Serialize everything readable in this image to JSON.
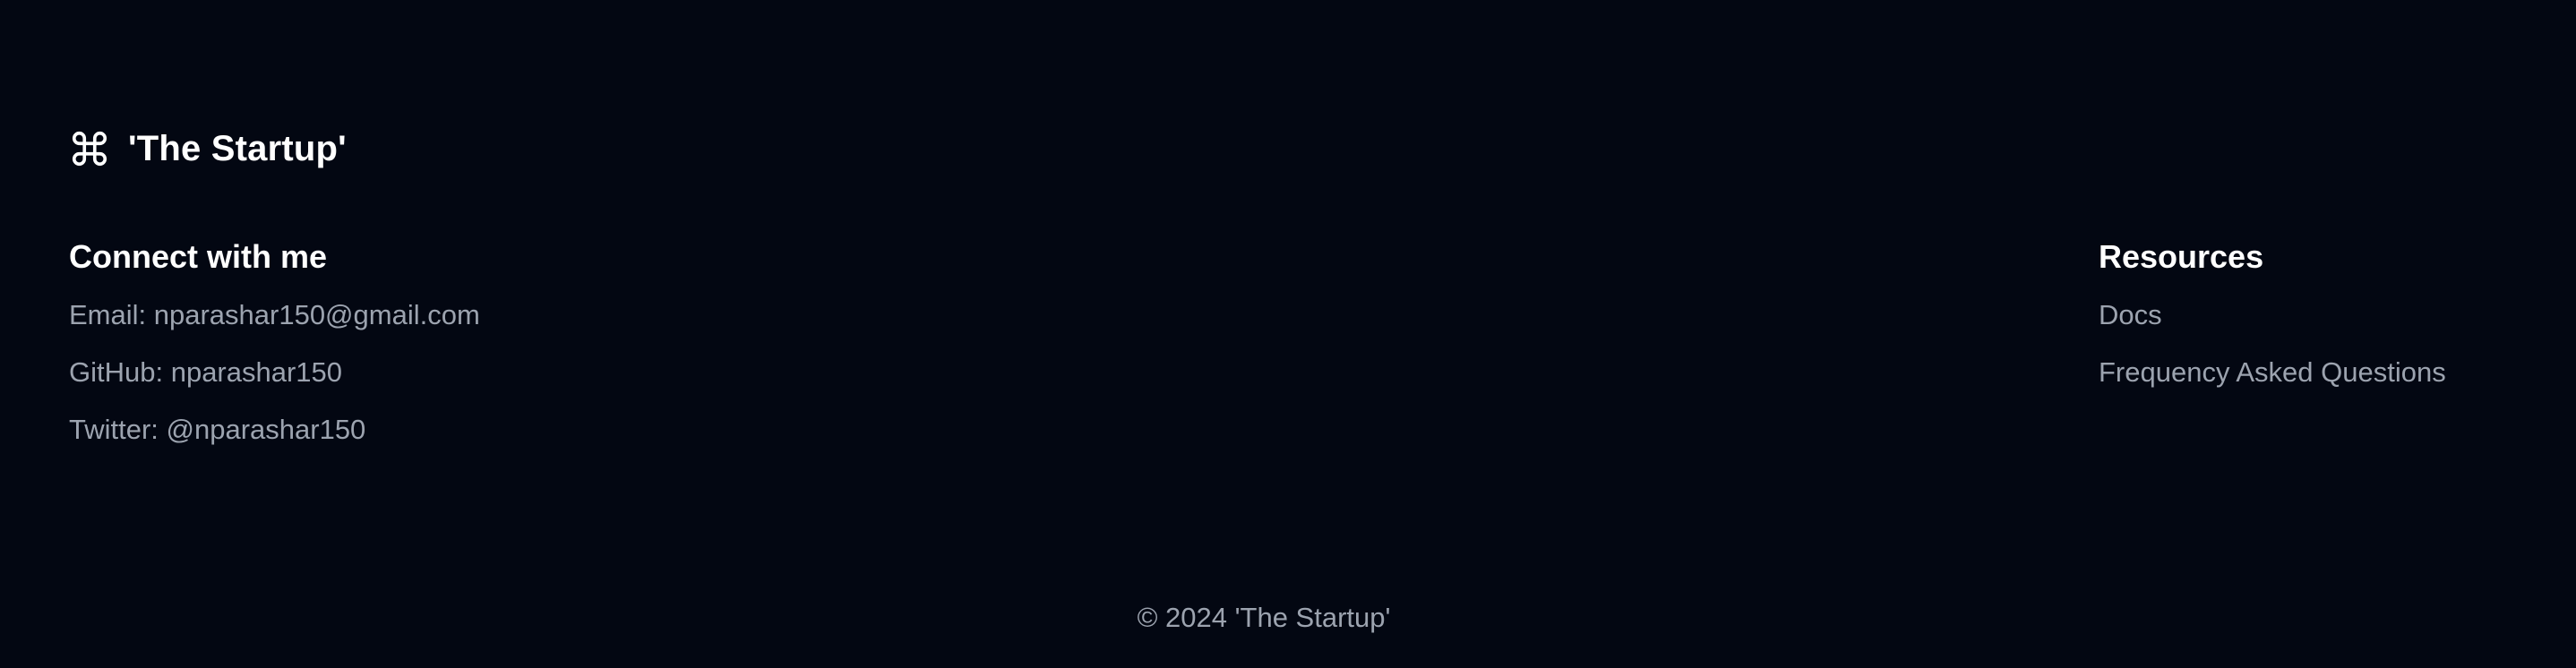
{
  "brand": {
    "icon": "command-icon",
    "title": "'The Startup'"
  },
  "connect": {
    "heading": "Connect with me",
    "items": [
      "Email: nparashar150@gmail.com",
      "GitHub: nparashar150",
      "Twitter: @nparashar150"
    ]
  },
  "resources": {
    "heading": "Resources",
    "items": [
      "Docs",
      "Frequency Asked Questions"
    ]
  },
  "footer": {
    "copyright": "© 2024 'The Startup'"
  },
  "colors": {
    "background": "#030712",
    "heading": "#ffffff",
    "muted": "#9ca3af"
  }
}
